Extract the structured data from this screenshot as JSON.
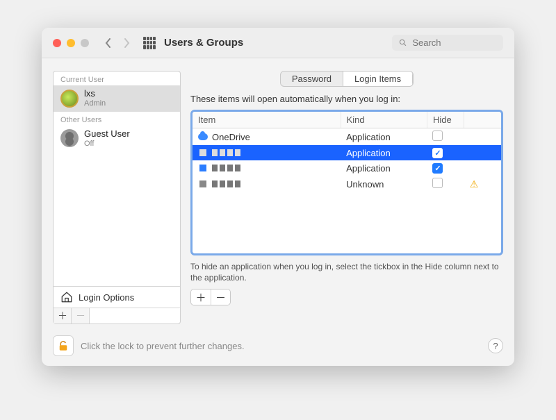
{
  "window": {
    "title": "Users & Groups",
    "search_placeholder": "Search"
  },
  "sidebar": {
    "current_label": "Current User",
    "other_label": "Other Users",
    "current": {
      "name": "lxs",
      "role": "Admin"
    },
    "guest": {
      "name": "Guest User",
      "role": "Off"
    },
    "login_options": "Login Options"
  },
  "tabs": {
    "password": "Password",
    "login_items": "Login Items"
  },
  "main": {
    "description": "These items will open automatically when you log in:",
    "columns": {
      "item": "Item",
      "kind": "Kind",
      "hide": "Hide"
    },
    "rows": [
      {
        "name": "OneDrive",
        "kind": "Application",
        "hide": false,
        "icon": "cloud",
        "selected": false,
        "blurred": false,
        "warn": false
      },
      {
        "name": "",
        "kind": "Application",
        "hide": true,
        "icon": "white",
        "selected": true,
        "blurred": true,
        "warn": false
      },
      {
        "name": "",
        "kind": "Application",
        "hide": true,
        "icon": "blue",
        "selected": false,
        "blurred": true,
        "warn": false
      },
      {
        "name": "",
        "kind": "Unknown",
        "hide": false,
        "icon": "grey",
        "selected": false,
        "blurred": true,
        "warn": true
      }
    ],
    "hint": "To hide an application when you log in, select the tickbox in the Hide column next to the application."
  },
  "footer": {
    "lock_text": "Click the lock to prevent further changes.",
    "help": "?"
  },
  "glyphs": {
    "plus": "＋",
    "minus": "－"
  }
}
